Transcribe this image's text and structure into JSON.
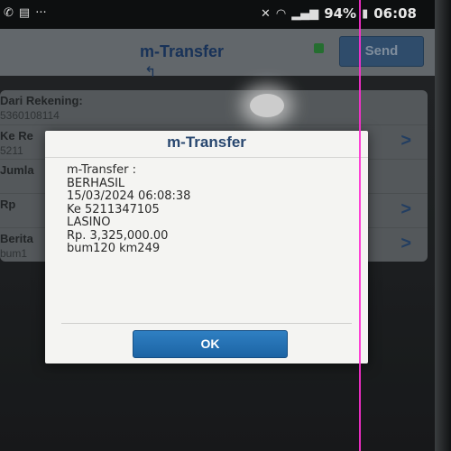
{
  "status_bar": {
    "icons_left": [
      "whatsapp-icon",
      "message-icon"
    ],
    "more": "···",
    "icons_right": [
      "mute-icon",
      "wifi-icon",
      "signal-icon"
    ],
    "battery": "94%",
    "time": "06:08"
  },
  "app": {
    "title": "m-Transfer",
    "send_label": "Send"
  },
  "form": {
    "rows": [
      {
        "label": "Dari Rekening:",
        "value": "5360108114"
      },
      {
        "label": "Ke Re",
        "value": "5211"
      },
      {
        "label": "Jumla",
        "value": ""
      },
      {
        "label": "Rp",
        "value": ""
      },
      {
        "label": "Berita",
        "value": "bum1"
      }
    ]
  },
  "dialog": {
    "title": "m-Transfer",
    "lines": [
      "m-Transfer :",
      "BERHASIL",
      "15/03/2024 06:08:38",
      "Ke 5211347105",
      "LASINO",
      "Rp. 3,325,000.00",
      "bum120 km249"
    ],
    "ok_label": "OK"
  },
  "colors": {
    "accent": "#1c64a4",
    "title_blue": "#28476f",
    "pink_artifact": "#ff2fd2"
  }
}
